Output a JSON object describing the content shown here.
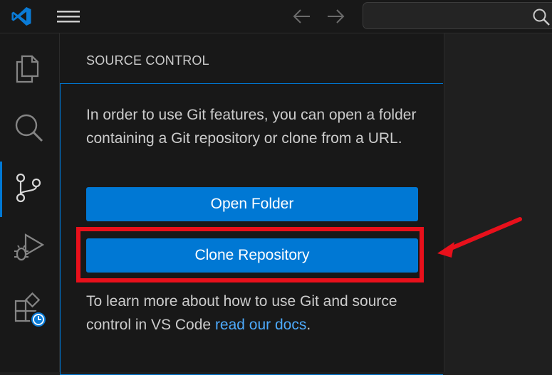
{
  "titlebar": {
    "logo_icon": "vscode-logo-icon",
    "menu_icon": "hamburger-menu-icon",
    "back_icon": "arrow-left-icon",
    "forward_icon": "arrow-right-icon",
    "search": {
      "value": "",
      "icon": "search-icon"
    }
  },
  "activity_bar": {
    "items": [
      {
        "icon": "files-icon",
        "active": false
      },
      {
        "icon": "search-icon",
        "active": false
      },
      {
        "icon": "source-control-icon",
        "active": true
      },
      {
        "icon": "run-debug-icon",
        "active": false
      },
      {
        "icon": "extensions-icon",
        "active": false
      }
    ]
  },
  "sidebar": {
    "title": "SOURCE CONTROL",
    "message": "In order to use Git features, you can open a folder containing a Git repository or clone from a URL.",
    "buttons": {
      "open_folder": "Open Folder",
      "clone_repository": "Clone Repository"
    },
    "learn_more_prefix": "To learn more about how to use Git and source control in VS Code ",
    "learn_more_link": "read our docs",
    "learn_more_suffix": "."
  },
  "annotation": {
    "highlight_color": "#e8101b",
    "arrow_color": "#e8101b"
  },
  "colors": {
    "accent": "#0078d4",
    "link": "#4daafc",
    "sidebar_bg": "#181818",
    "editor_bg": "#1f1f1f"
  }
}
